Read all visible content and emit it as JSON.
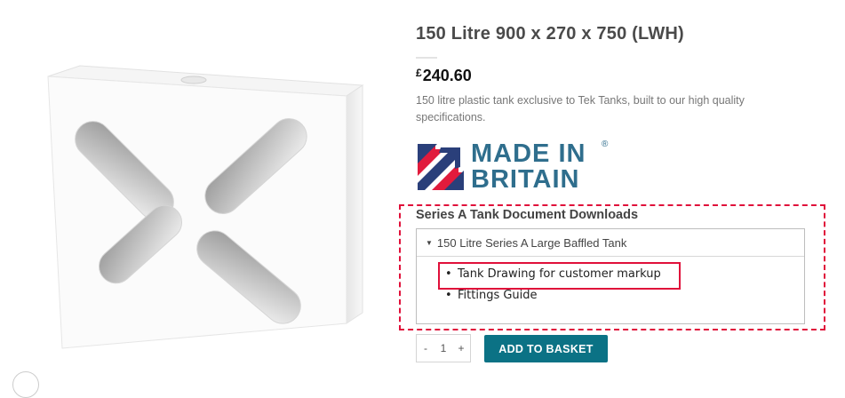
{
  "product": {
    "title": "150 Litre 900 x 270 x 750 (LWH)",
    "currency_symbol": "£",
    "price": "240.60",
    "description": "150 litre plastic tank exclusive to Tek Tanks, built to our high quality specifications."
  },
  "badge": {
    "line1": "MADE IN",
    "line2": "BRITAIN",
    "registered": "®"
  },
  "downloads": {
    "heading": "Series A Tank Document Downloads",
    "section_label": "150 Litre Series A Large Baffled Tank",
    "items": [
      "Tank Drawing for customer markup",
      "Fittings Guide"
    ]
  },
  "cart": {
    "minus": "-",
    "quantity": "1",
    "plus": "+",
    "add_label": "ADD TO BASKET"
  },
  "colors": {
    "accent": "#0b7285",
    "annotation": "#e0103a",
    "badge_blue": "#2f6e8d",
    "badge_red": "#e11b3c"
  }
}
